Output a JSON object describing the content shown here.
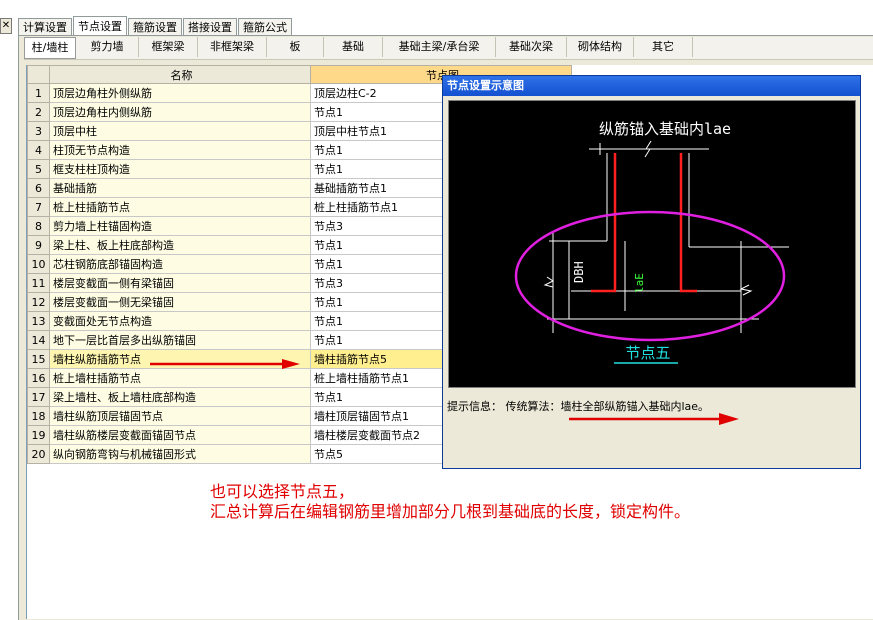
{
  "window": {
    "close_symbol": "✕"
  },
  "tabs": [
    "计算设置",
    "节点设置",
    "箍筋设置",
    "搭接设置",
    "箍筋公式"
  ],
  "subtabs": [
    "柱/墙柱",
    "剪力墙",
    "框架梁",
    "非框架梁",
    "板",
    "基础",
    "基础主梁/承台梁",
    "基础次梁",
    "砌体结构",
    "其它"
  ],
  "grid": {
    "columns": {
      "name": "名称",
      "node": "节点图"
    },
    "rows": [
      {
        "no": "1",
        "name": "顶层边角柱外侧纵筋",
        "value": "顶层边柱C-2"
      },
      {
        "no": "2",
        "name": "顶层边角柱内侧纵筋",
        "value": "节点1"
      },
      {
        "no": "3",
        "name": "顶层中柱",
        "value": "顶层中柱节点1"
      },
      {
        "no": "4",
        "name": "柱顶无节点构造",
        "value": "节点1"
      },
      {
        "no": "5",
        "name": "框支柱柱顶构造",
        "value": "节点1"
      },
      {
        "no": "6",
        "name": "基础插筋",
        "value": "基础插筋节点1"
      },
      {
        "no": "7",
        "name": "桩上柱插筋节点",
        "value": "桩上柱插筋节点1"
      },
      {
        "no": "8",
        "name": "剪力墙上柱锚固构造",
        "value": "节点3"
      },
      {
        "no": "9",
        "name": "梁上柱、板上柱底部构造",
        "value": "节点1"
      },
      {
        "no": "10",
        "name": "芯柱钢筋底部锚固构造",
        "value": "节点1"
      },
      {
        "no": "11",
        "name": "楼层变截面一侧有梁锚固",
        "value": "节点3"
      },
      {
        "no": "12",
        "name": "楼层变截面一侧无梁锚固",
        "value": "节点1"
      },
      {
        "no": "13",
        "name": "变截面处无节点构造",
        "value": "节点1"
      },
      {
        "no": "14",
        "name": "地下一层比首层多出纵筋锚固",
        "value": "节点1"
      },
      {
        "no": "15",
        "name": "墙柱纵筋插筋节点",
        "value": "墙柱插筋节点5"
      },
      {
        "no": "16",
        "name": "桩上墙柱插筋节点",
        "value": "桩上墙柱插筋节点1"
      },
      {
        "no": "17",
        "name": "梁上墙柱、板上墙柱底部构造",
        "value": "节点1"
      },
      {
        "no": "18",
        "name": "墙柱纵筋顶层锚固节点",
        "value": "墙柱顶层锚固节点1"
      },
      {
        "no": "19",
        "name": "墙柱纵筋楼层变截面锚固节点",
        "value": "墙柱楼层变截面节点2"
      },
      {
        "no": "20",
        "name": "纵向钢筋弯钩与机械锚固形式",
        "value": "节点5"
      }
    ]
  },
  "dialog": {
    "title": "节点设置示意图",
    "diagram": {
      "heading": "纵筋锚入基础内lae",
      "label_dbh": "DBH",
      "label_lae": "laE",
      "node_name": "节点五"
    },
    "hint": "提示信息： 传统算法：墙柱全部纵筋锚入基础内lae。"
  },
  "annotation": {
    "line1": "也可以选择节点五，",
    "line2": "汇总计算后在编辑钢筋里增加部分几根到基础底的长度，锁定构件。"
  },
  "colors": {
    "annotation": "#e00000",
    "ellipse": "#e020e0",
    "rebar": "#ff2020",
    "node_label": "#20e0e0"
  }
}
